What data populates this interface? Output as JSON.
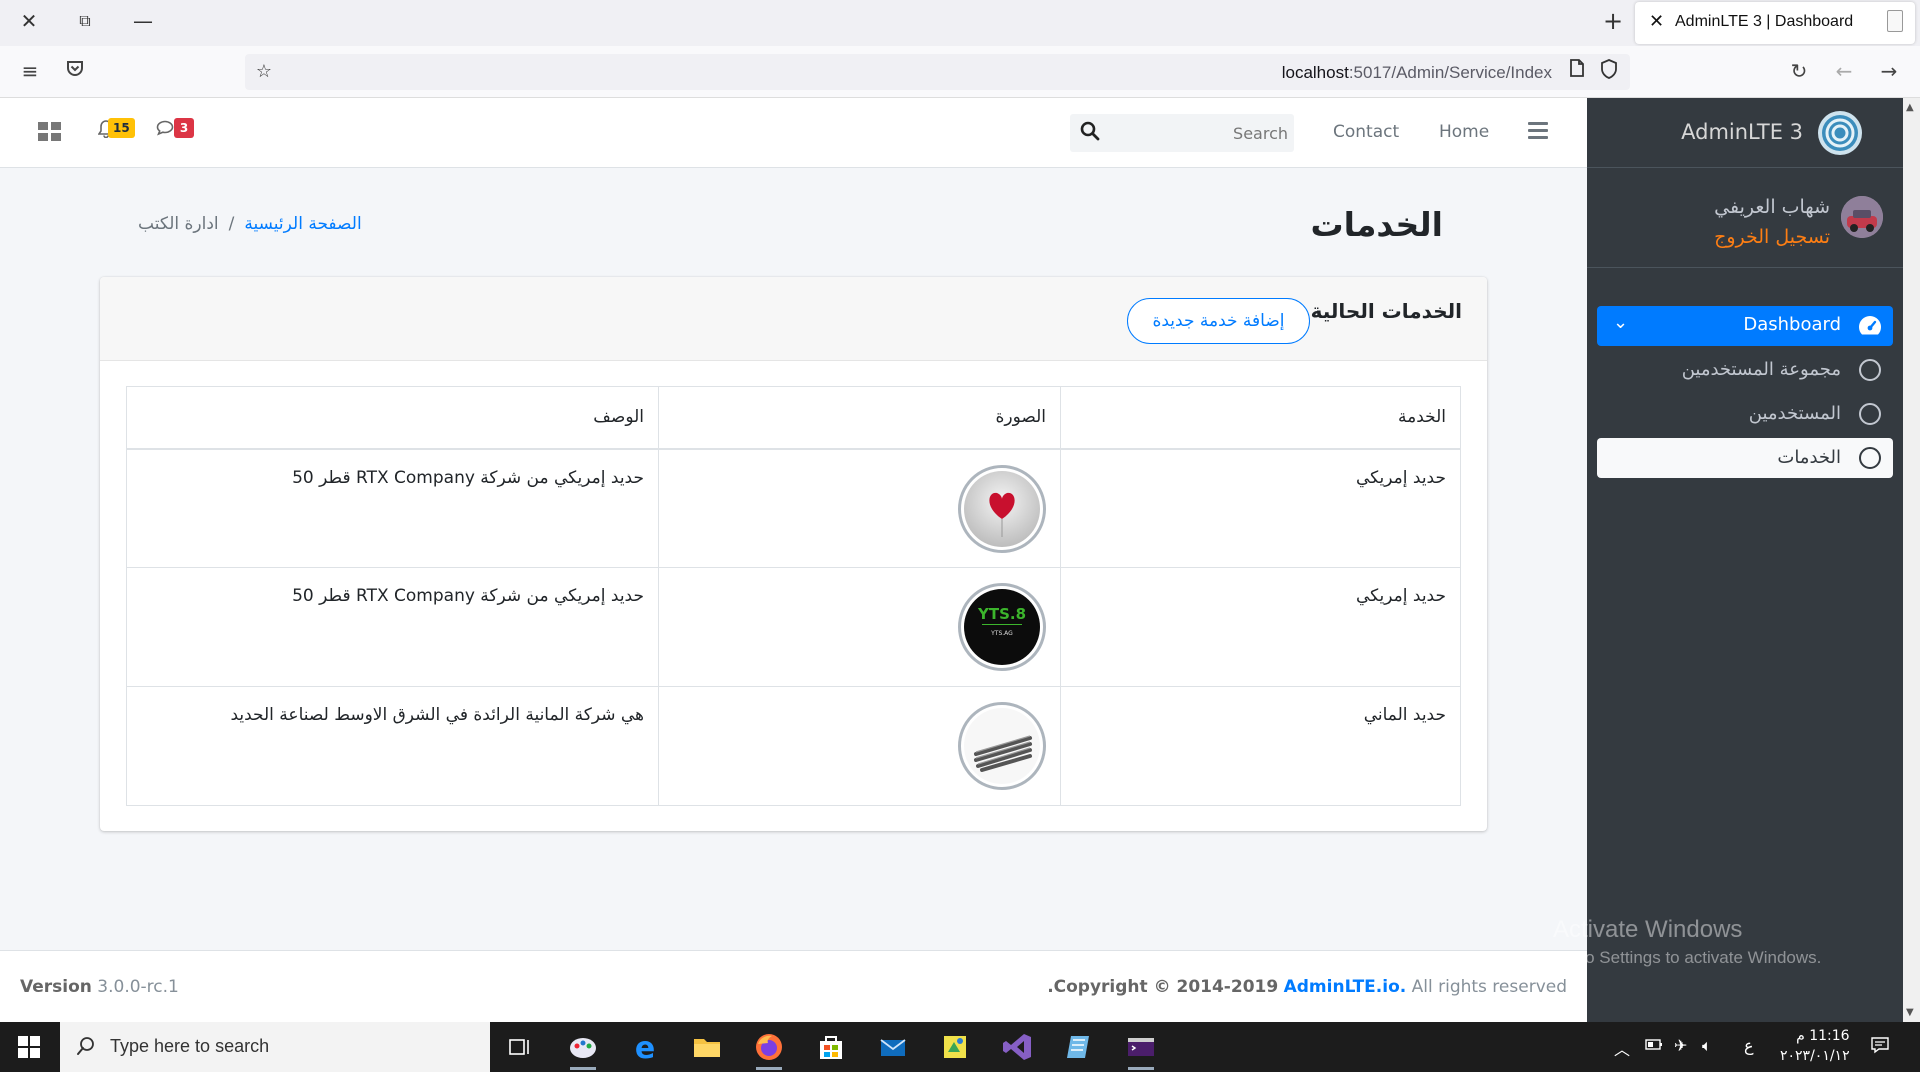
{
  "browser": {
    "tab_title": "AdminLTE 3 | Dashboard",
    "url_host": "localhost",
    "url_path": ":5017/Admin/Service/Index"
  },
  "topnav": {
    "notifications_count": "15",
    "messages_count": "3",
    "search_placeholder": "Search",
    "contact_label": "Contact",
    "home_label": "Home"
  },
  "page": {
    "title": "الخدمات",
    "breadcrumb": {
      "home": "الصفحة الرئيسية",
      "separator": "/",
      "current": "ادارة الكتب"
    }
  },
  "card": {
    "title": "الخدمات الحالية",
    "add_button": "إضافة خدمة جديدة"
  },
  "table": {
    "headers": {
      "service": "الخدمة",
      "image": "الصورة",
      "description": "الوصف"
    },
    "rows": [
      {
        "service": "حديد إمريكي",
        "image_icon": "heart-balloon-image",
        "description": "حديد إمريكي من شركة RTX Company قطر 50"
      },
      {
        "service": "حديد إمريكي",
        "image_icon": "yts-logo-image",
        "description": "حديد إمريكي من شركة RTX Company قطر 50"
      },
      {
        "service": "حديد الماني",
        "image_icon": "steel-rebar-image",
        "description": "هي شركة المانية الرائدة في الشرق الاوسط لصناعة الحديد"
      }
    ]
  },
  "footer": {
    "version_label": "Version",
    "version_value": "3.0.0-rc.1",
    "copyright_prefix": ".Copyright © 2014-2019",
    "brand": "AdminLTE.io.",
    "rights": "All rights reserved"
  },
  "sidebar": {
    "brand": "AdminLTE 3",
    "user_name": "شهاب العريفي",
    "logout": "تسجيل الخروج",
    "items": [
      {
        "label": "Dashboard",
        "icon": "tachometer-icon"
      },
      {
        "label": "مجموعة المستخدمين",
        "icon": "circle-icon"
      },
      {
        "label": "المستخدمين",
        "icon": "circle-icon"
      },
      {
        "label": "الخدمات",
        "icon": "circle-icon"
      }
    ]
  },
  "watermark": {
    "line1": "Activate Windows",
    "line2": "Go to Settings to activate Windows."
  },
  "taskbar": {
    "search_placeholder": "Type here to search",
    "clock_time": "11:16 م",
    "clock_date": "٢٠٢٣/٠١/١٢",
    "lang": "ع"
  },
  "colors": {
    "primary": "#007bff",
    "sidebar_bg": "#343a40",
    "logout": "#fd7e14",
    "badge_warning": "#ffc107",
    "badge_danger": "#dc3545"
  }
}
